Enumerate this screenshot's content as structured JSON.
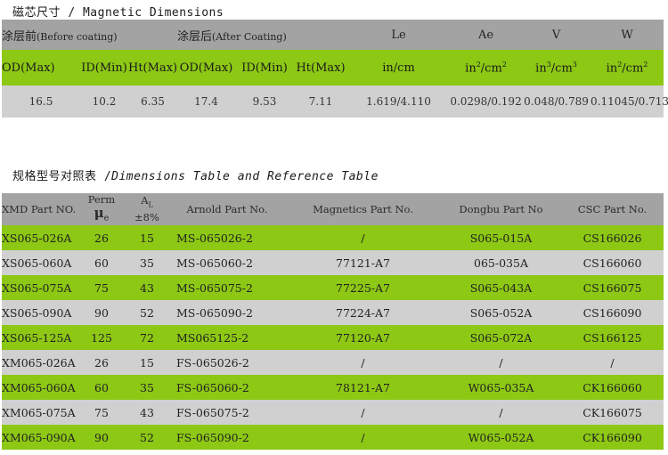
{
  "sections": {
    "dimensions_title": "磁芯尺寸 / Magnetic Dimensions",
    "table_title_cn": "规格型号对照表 /",
    "table_title_en": "Dimensions Table and Reference Table"
  },
  "dim_table": {
    "before_cn": "涂层前",
    "before_en": "(Before coating)",
    "after_cn": "涂层后",
    "after_en": "(After Coating)",
    "le": "Le",
    "ae": "Ae",
    "v": "V",
    "w": "W",
    "sub_headers": [
      "OD(Max)",
      "ID(Min)",
      "Ht(Max)",
      "OD(Max)",
      "ID(Min)",
      "Ht(Max)",
      "in/cm",
      "in",
      "cm",
      "in",
      "cm",
      "in",
      "cm"
    ],
    "values": [
      "16.5",
      "10.2",
      "6.35",
      "17.4",
      "9.53",
      "7.11",
      "1.619/4.110",
      "0.0298/0.192",
      "0.048/0.789",
      "0.11045/0.713"
    ]
  },
  "ref_table": {
    "headers": {
      "xmd": "XMD Part NO.",
      "perm": "Perm",
      "mu": "μ",
      "mu_sub": "e",
      "al": "A",
      "al_sub": "L",
      "al_tol": "±8%",
      "arnold": "Arnold Part No.",
      "magnetics": "Magnetics Part No.",
      "dongbu": "Dongbu Part No",
      "csc": "CSC Part No."
    },
    "rows": [
      {
        "xmd": "XS065-026A",
        "perm": "26",
        "al": "15",
        "arnold": "MS-065026-2",
        "magnetics": "/",
        "dongbu": "S065-015A",
        "csc": "CS166026"
      },
      {
        "xmd": "XS065-060A",
        "perm": "60",
        "al": "35",
        "arnold": "MS-065060-2",
        "magnetics": "77121-A7",
        "dongbu": "065-035A",
        "csc": "CS166060"
      },
      {
        "xmd": "XS065-075A",
        "perm": "75",
        "al": "43",
        "arnold": "MS-065075-2",
        "magnetics": "77225-A7",
        "dongbu": "S065-043A",
        "csc": "CS166075"
      },
      {
        "xmd": "XS065-090A",
        "perm": "90",
        "al": "52",
        "arnold": "MS-065090-2",
        "magnetics": "77224-A7",
        "dongbu": "S065-052A",
        "csc": "CS166090"
      },
      {
        "xmd": "XS065-125A",
        "perm": "125",
        "al": "72",
        "arnold": "MS065125-2",
        "magnetics": "77120-A7",
        "dongbu": "S065-072A",
        "csc": "CS166125"
      },
      {
        "xmd": "XM065-026A",
        "perm": "26",
        "al": "15",
        "arnold": "FS-065026-2",
        "magnetics": "/",
        "dongbu": "/",
        "csc": "/"
      },
      {
        "xmd": "XM065-060A",
        "perm": "60",
        "al": "35",
        "arnold": "FS-065060-2",
        "magnetics": "78121-A7",
        "dongbu": "W065-035A",
        "csc": "CK166060"
      },
      {
        "xmd": "XM065-075A",
        "perm": "75",
        "al": "43",
        "arnold": "FS-065075-2",
        "magnetics": "/",
        "dongbu": "/",
        "csc": "CK166075"
      },
      {
        "xmd": "XM065-090A",
        "perm": "90",
        "al": "52",
        "arnold": "FS-065090-2",
        "magnetics": "/",
        "dongbu": "W065-052A",
        "csc": "CK166090"
      }
    ]
  },
  "colors": {
    "green": "#8dc814",
    "gray_header": "#a3a3a3",
    "gray_row": "#d0d0d0"
  }
}
